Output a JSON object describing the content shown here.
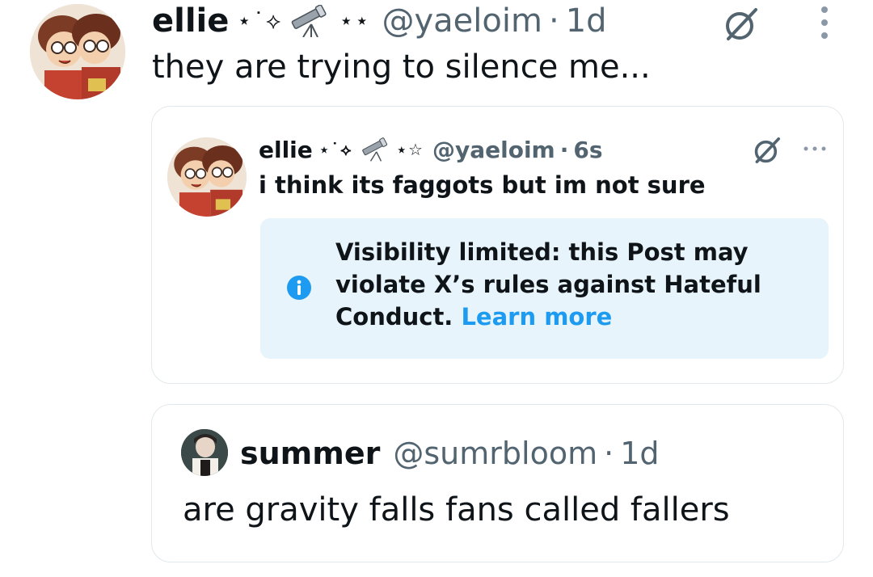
{
  "main_post": {
    "display_name": "ellie",
    "name_decoration": "⋆˙⟡",
    "name_decoration_2": "⋆⋆",
    "handle": "@yaeloim",
    "separator": "·",
    "timestamp": "1d",
    "text": "they are trying to silence me...",
    "icons": [
      "avatar",
      "telescope-icon",
      "grok-icon",
      "more-options-icon"
    ]
  },
  "quoted_post": {
    "display_name": "ellie",
    "name_decoration": "⋆˙⟡",
    "name_decoration_2": "⋆☆",
    "handle": "@yaeloim",
    "separator": "·",
    "timestamp": "6s",
    "text": "i think its faggots but im not sure",
    "notice": {
      "text": "Visibility limited: this Post may violate X’s rules against Hateful Conduct.",
      "link_label": "Learn more",
      "icon": "info-icon"
    }
  },
  "reply_card": {
    "display_name": "summer",
    "handle": "@sumrbloom",
    "separator": "·",
    "timestamp": "1d",
    "text": "are gravity falls fans called fallers"
  },
  "colors": {
    "text_primary": "#0f1419",
    "text_secondary": "#536471",
    "link": "#1d9bf0",
    "notice_bg": "#e8f4fb",
    "border": "#e2e8ec"
  }
}
